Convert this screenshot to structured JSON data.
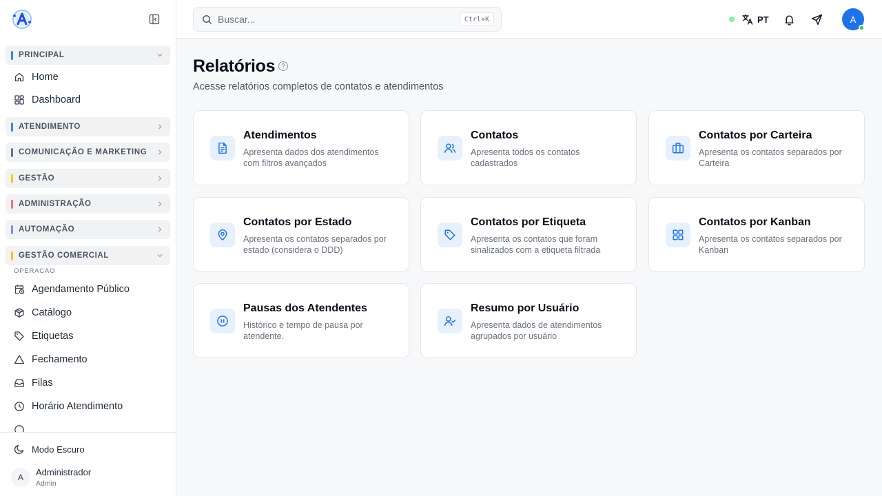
{
  "sidebar": {
    "logo_letter": "A",
    "sections": [
      {
        "label": "PRINCIPAL",
        "color": "#3b82f6",
        "expanded": true
      },
      {
        "label": "ATENDIMENTO",
        "color": "#3b82f6",
        "expanded": false
      },
      {
        "label": "COMUNICAÇÃO E MARKETING",
        "color": "#6b7280",
        "expanded": false
      },
      {
        "label": "GESTÃO",
        "color": "#facc15",
        "expanded": false
      },
      {
        "label": "ADMINISTRAÇÃO",
        "color": "#f87171",
        "expanded": false
      },
      {
        "label": "AUTOMAÇÃO",
        "color": "#818cf8",
        "expanded": false
      },
      {
        "label": "GESTÃO COMERCIAL",
        "color": "#fbbf24",
        "expanded": true
      }
    ],
    "principal_items": [
      {
        "label": "Home",
        "icon": "home-icon"
      },
      {
        "label": "Dashboard",
        "icon": "dashboard-icon"
      }
    ],
    "subheading": "OPERACAO",
    "comercial_items": [
      {
        "label": "Agendamento Público",
        "icon": "calendar-clock-icon"
      },
      {
        "label": "Catálogo",
        "icon": "package-icon"
      },
      {
        "label": "Etiquetas",
        "icon": "tag-icon"
      },
      {
        "label": "Fechamento",
        "icon": "triangle-alert-icon"
      },
      {
        "label": "Filas",
        "icon": "inbox-icon"
      },
      {
        "label": "Horário Atendimento",
        "icon": "clock-icon"
      }
    ],
    "dark_mode_label": "Modo Escuro",
    "user": {
      "initial": "A",
      "name": "Administrador",
      "role": "Admin"
    }
  },
  "topbar": {
    "search_placeholder": "Buscar...",
    "shortcut": "Ctrl+K",
    "language": "PT",
    "avatar_initial": "A",
    "status_color": "#86efac",
    "accent": "#1d74e8"
  },
  "page": {
    "title": "Relatórios",
    "subtitle": "Acesse relatórios completos de contatos e atendimentos"
  },
  "cards": [
    {
      "title": "Atendimentos",
      "desc": "Apresenta dados dos atendimentos com filtros avançados",
      "icon": "file-text-icon"
    },
    {
      "title": "Contatos",
      "desc": "Apresenta todos os contatos cadastrados",
      "icon": "users-icon"
    },
    {
      "title": "Contatos por Carteira",
      "desc": "Apresenta os contatos separados por Carteira",
      "icon": "briefcase-icon"
    },
    {
      "title": "Contatos por Estado",
      "desc": "Apresenta os contatos separados por estado (considera o DDD)",
      "icon": "map-pin-icon"
    },
    {
      "title": "Contatos por Etiqueta",
      "desc": "Apresenta os contatos que foram sinalizados com a etiqueta filtrada",
      "icon": "tag-icon"
    },
    {
      "title": "Contatos por Kanban",
      "desc": "Apresenta os contatos separados por Kanban",
      "icon": "layout-grid-icon"
    },
    {
      "title": "Pausas dos Atendentes",
      "desc": "Histórico e tempo de pausa por atendente.",
      "icon": "pause-circle-icon"
    },
    {
      "title": "Resumo por Usuário",
      "desc": "Apresenta dados de atendimentos agrupados por usuário",
      "icon": "user-check-icon"
    }
  ]
}
